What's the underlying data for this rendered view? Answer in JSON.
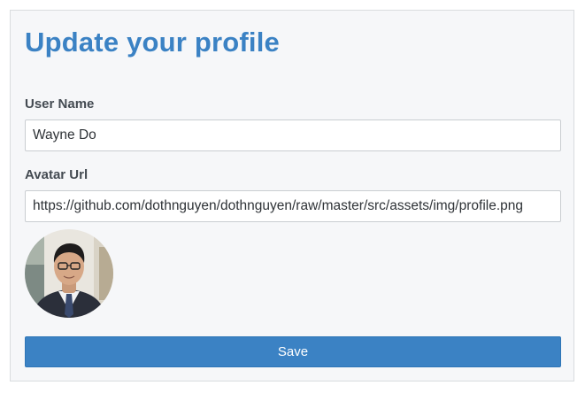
{
  "profile": {
    "title": "Update your profile",
    "user_name_label": "User Name",
    "user_name_value": "Wayne Do",
    "avatar_url_label": "Avatar Url",
    "avatar_url_value": "https://github.com/dothnguyen/dothnguyen/raw/master/src/assets/img/profile.png",
    "avatar_image": "profile-photo-man-with-glasses-suit-tie",
    "save_label": "Save"
  },
  "colors": {
    "accent": "#3b82c4",
    "panel_bg": "#f6f7f9",
    "border": "#d9dcdf",
    "label_text": "#444b52"
  }
}
